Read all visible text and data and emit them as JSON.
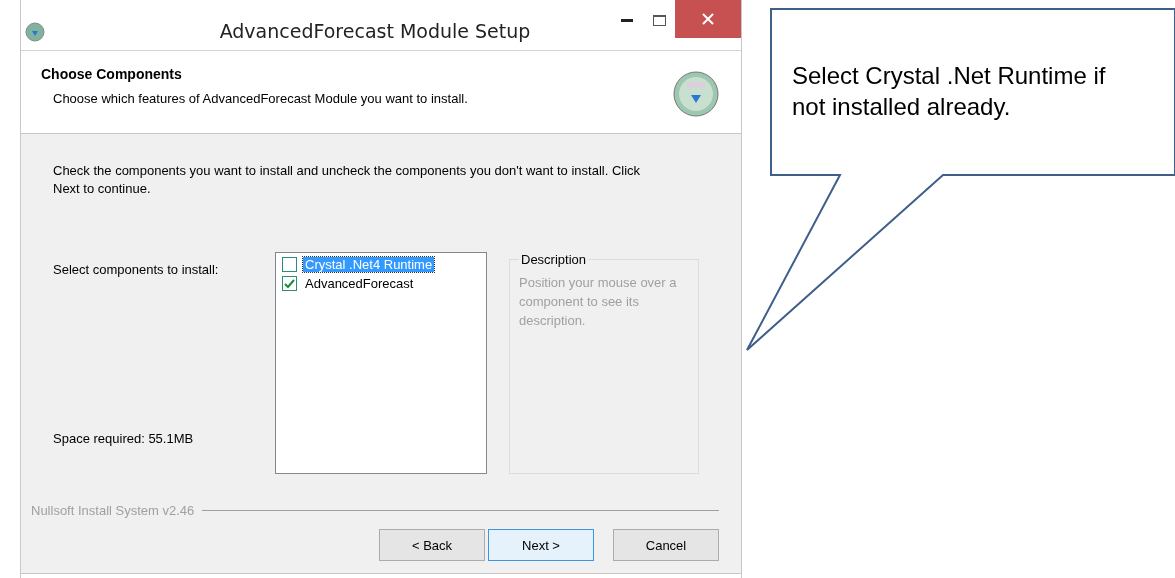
{
  "window": {
    "title": "AdvancedForecast Module Setup"
  },
  "header": {
    "title": "Choose Components",
    "subtitle": "Choose which features of AdvancedForecast Module you want to install."
  },
  "intro": "Check the components you want to install and uncheck the components you don't want to install. Click Next to continue.",
  "select_label": "Select components to install:",
  "components": [
    {
      "label": "Crystal .Net4 Runtime",
      "checked": false,
      "selected": true
    },
    {
      "label": "AdvancedForecast",
      "checked": true,
      "selected": false
    }
  ],
  "description": {
    "title": "Description",
    "text": "Position your mouse over a component to see its description."
  },
  "space_required": "Space required: 55.1MB",
  "branding": "Nullsoft Install System v2.46",
  "buttons": [
    {
      "label": "< Back",
      "focused": false
    },
    {
      "label": "Next >",
      "focused": true
    },
    {
      "label": "Cancel",
      "focused": false
    }
  ],
  "callout": {
    "text": "Select Crystal .Net Runtime if not installed already."
  }
}
